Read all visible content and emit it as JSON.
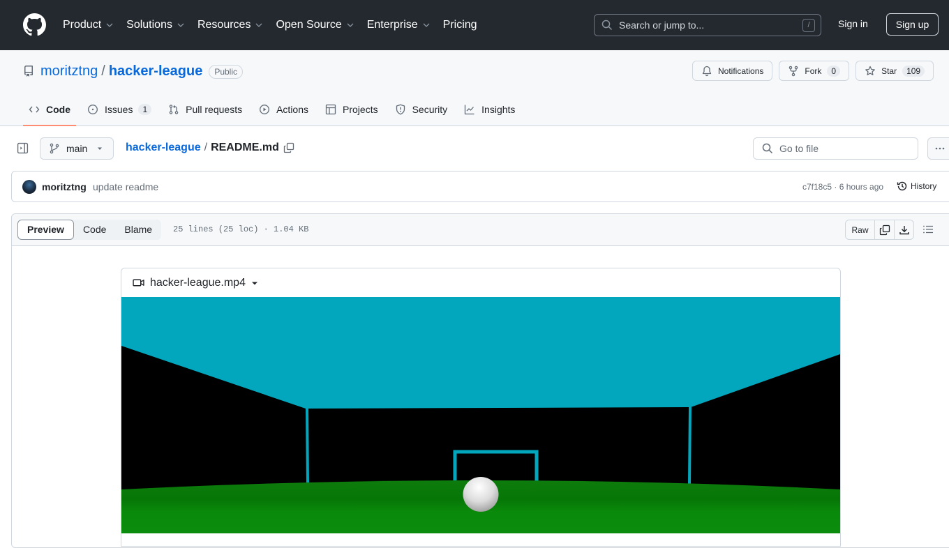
{
  "header": {
    "nav": [
      {
        "label": "Product",
        "has_dropdown": true
      },
      {
        "label": "Solutions",
        "has_dropdown": true
      },
      {
        "label": "Resources",
        "has_dropdown": true
      },
      {
        "label": "Open Source",
        "has_dropdown": true
      },
      {
        "label": "Enterprise",
        "has_dropdown": true
      },
      {
        "label": "Pricing",
        "has_dropdown": false
      }
    ],
    "search_placeholder": "Search or jump to...",
    "search_shortcut": "/",
    "sign_in": "Sign in",
    "sign_up": "Sign up"
  },
  "repo": {
    "owner": "moritztng",
    "separator": "/",
    "name": "hacker-league",
    "visibility": "Public",
    "notifications_label": "Notifications",
    "fork_label": "Fork",
    "fork_count": "0",
    "star_label": "Star",
    "star_count": "109",
    "tabs": [
      {
        "label": "Code",
        "icon": "code-icon",
        "active": true
      },
      {
        "label": "Issues",
        "icon": "issue-icon",
        "count": "1"
      },
      {
        "label": "Pull requests",
        "icon": "pull-request-icon"
      },
      {
        "label": "Actions",
        "icon": "play-icon"
      },
      {
        "label": "Projects",
        "icon": "table-icon"
      },
      {
        "label": "Security",
        "icon": "shield-icon"
      },
      {
        "label": "Insights",
        "icon": "graph-icon"
      }
    ]
  },
  "file_nav": {
    "branch": "main",
    "breadcrumb_repo": "hacker-league",
    "breadcrumb_sep": "/",
    "file_name": "README.md",
    "goto_placeholder": "Go to file"
  },
  "commit": {
    "author": "moritztng",
    "message": "update readme",
    "meta": "c7f18c5 · 6 hours ago",
    "history_label": "History"
  },
  "file_view": {
    "modes": [
      "Preview",
      "Code",
      "Blame"
    ],
    "active_mode": "Preview",
    "info": "25 lines (25 loc) · 1.04 KB",
    "raw_label": "Raw"
  },
  "video": {
    "filename": "hacker-league.mp4",
    "colors": {
      "sky": "#03a7bd",
      "wall": "#000000",
      "field": "#0a8a0a",
      "ball": "#e6e6e6"
    }
  },
  "colors": {
    "header_bg": "#24292f",
    "link": "#0969da",
    "tab_underline": "#fd8c73"
  }
}
